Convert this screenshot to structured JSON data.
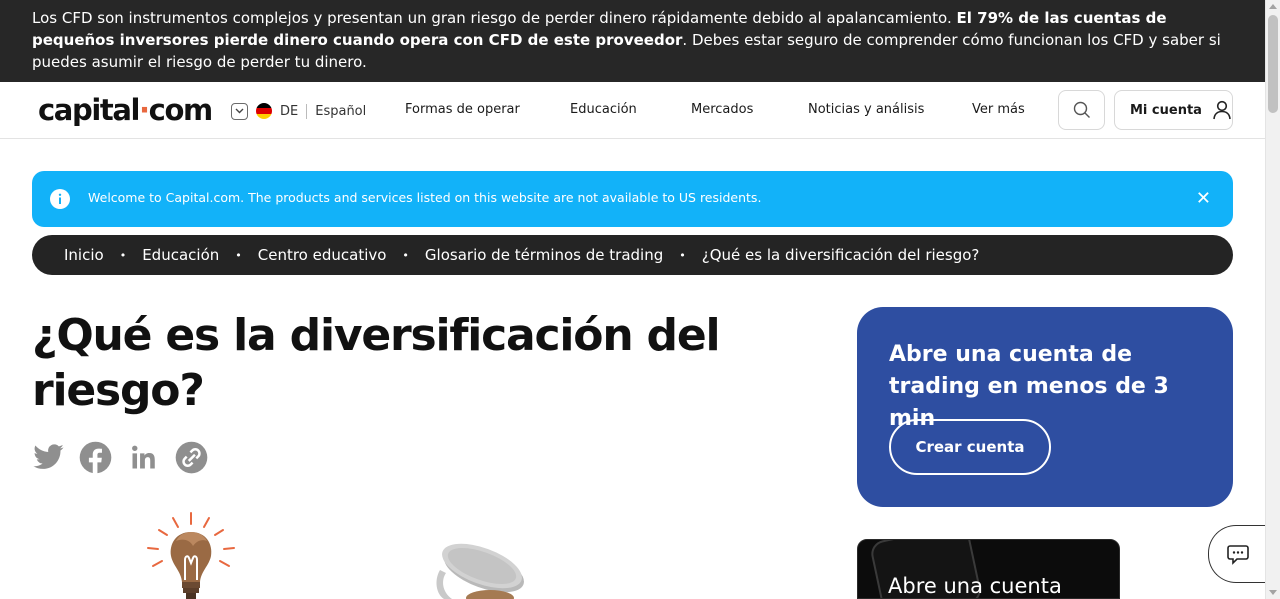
{
  "risk_warning": {
    "part1": "Los CFD son instrumentos complejos y presentan un gran riesgo de perder dinero rápidamente debido al apalancamiento. ",
    "bold": "El 79% de las cuentas de pequeños inversores pierde dinero cuando opera con CFD de este proveedor",
    "part2": ". Debes estar seguro de comprender cómo funcionan los CFD y saber si puedes asumir el riesgo de perder tu dinero."
  },
  "header": {
    "logo_left": "capital",
    "logo_dot": "·",
    "logo_right": "com",
    "lang_code": "DE",
    "lang_name": "Español",
    "nav": [
      "Formas de operar",
      "Educación",
      "Mercados",
      "Noticias y análisis",
      "Ver más"
    ],
    "account_label": "Mi cuenta"
  },
  "notice": {
    "message": "Welcome to Capital.com. The products and services listed on this website are not available to US residents.",
    "close": "✕"
  },
  "breadcrumb": [
    "Inicio",
    "Educación",
    "Centro educativo",
    "Glosario de términos de trading",
    "¿Qué es la diversificación del riesgo?"
  ],
  "breadcrumb_separator": "•",
  "article": {
    "title": "¿Qué es la diversificación del riesgo?"
  },
  "social": [
    "twitter-icon",
    "facebook-icon",
    "linkedin-icon",
    "copy-link-icon"
  ],
  "cta": {
    "heading": "Abre una cuenta de trading en menos de 3 min",
    "button": "Crear cuenta"
  },
  "promo": {
    "text": "Abre una cuenta"
  },
  "colors": {
    "risk_bar": "#272727",
    "notice": "#12b2f9",
    "breadcrumb_bg": "#242424",
    "cta_card": "#2e4ea1",
    "logo_dot": "#e8683f"
  }
}
